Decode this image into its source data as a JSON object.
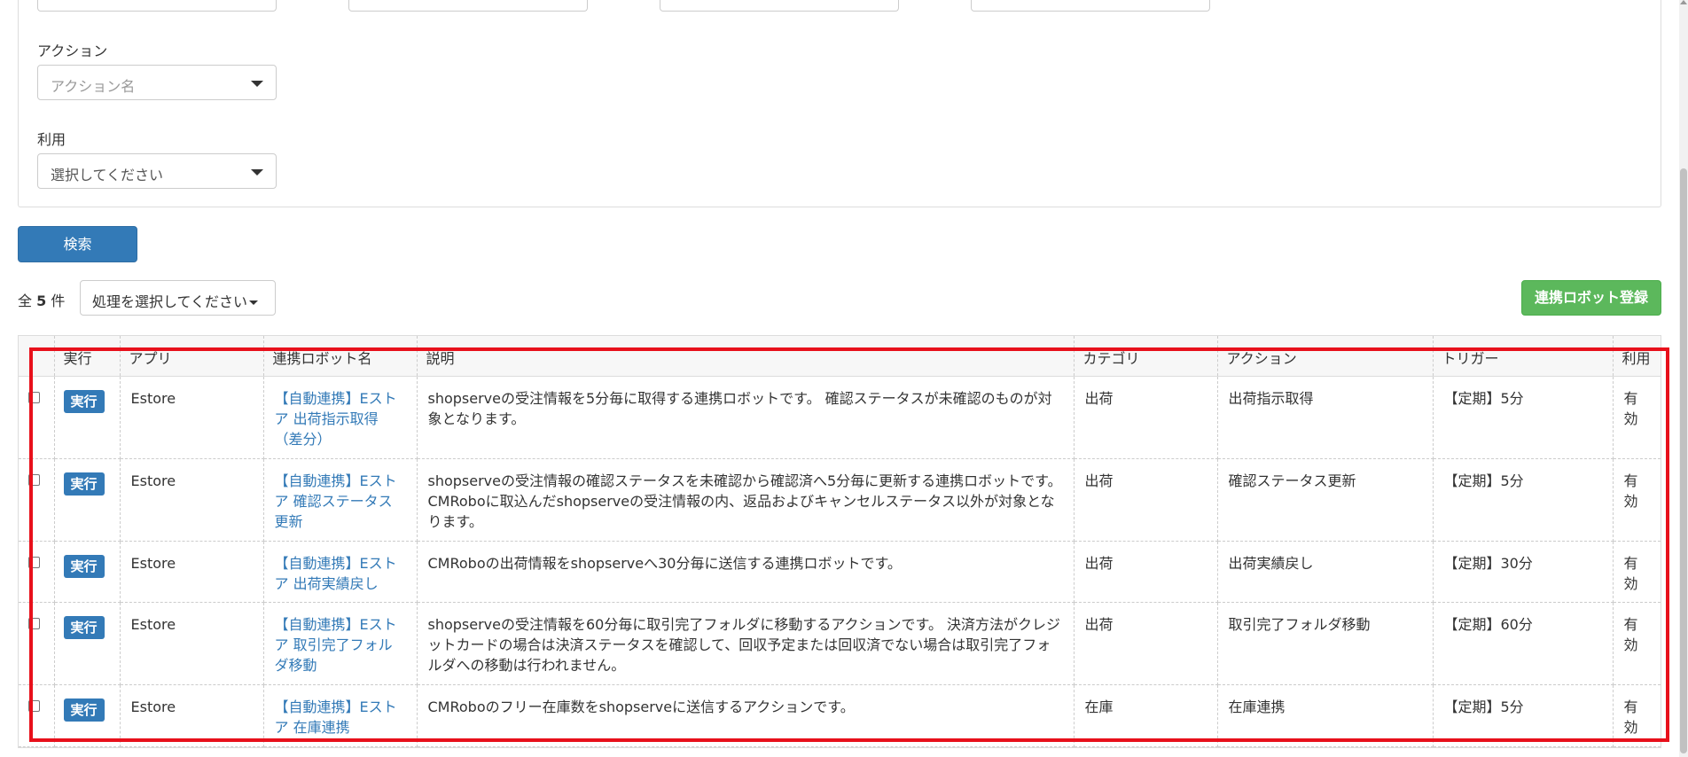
{
  "filters": {
    "action_label": "アクション",
    "action_placeholder": "アクション名",
    "use_label": "利用",
    "use_value": "選択してください"
  },
  "search_button": "検索",
  "list": {
    "count_prefix": "全",
    "count_value": "5",
    "count_suffix": "件",
    "bulk_action": "処理を選択してください",
    "register_button": "連携ロボット登録"
  },
  "table": {
    "headers": [
      "",
      "実行",
      "アプリ",
      "連携ロボット名",
      "説明",
      "カテゴリ",
      "アクション",
      "トリガー",
      "利用"
    ],
    "rows": [
      {
        "run": "実行",
        "app": "Estore",
        "name": "【自動連携】Eストア 出荷指示取得（差分）",
        "desc": "shopserveの受注情報を5分毎に取得する連携ロボットです。 確認ステータスが未確認のものが対象となります。",
        "category": "出荷",
        "action": "出荷指示取得",
        "trigger": "【定期】5分",
        "use": "有効"
      },
      {
        "run": "実行",
        "app": "Estore",
        "name": "【自動連携】Eストア 確認ステータス更新",
        "desc": "shopserveの受注情報の確認ステータスを未確認から確認済へ5分毎に更新する連携ロボットです。CMRoboに取込んだshopserveの受注情報の内、返品およびキャンセルステータス以外が対象となります。",
        "category": "出荷",
        "action": "確認ステータス更新",
        "trigger": "【定期】5分",
        "use": "有効"
      },
      {
        "run": "実行",
        "app": "Estore",
        "name": "【自動連携】Eストア 出荷実績戻し",
        "desc": "CMRoboの出荷情報をshopserveへ30分毎に送信する連携ロボットです。",
        "category": "出荷",
        "action": "出荷実績戻し",
        "trigger": "【定期】30分",
        "use": "有効"
      },
      {
        "run": "実行",
        "app": "Estore",
        "name": "【自動連携】Eストア 取引完了フォルダ移動",
        "desc": "shopserveの受注情報を60分毎に取引完了フォルダに移動するアクションです。 決済方法がクレジットカードの場合は決済ステータスを確認して、回収予定または回収済でない場合は取引完了フォルダへの移動は行われません。",
        "category": "出荷",
        "action": "取引完了フォルダ移動",
        "trigger": "【定期】60分",
        "use": "有効"
      },
      {
        "run": "実行",
        "app": "Estore",
        "name": "【自動連携】Eストア 在庫連携",
        "desc": "CMRoboのフリー在庫数をshopserveに送信するアクションです。",
        "category": "在庫",
        "action": "在庫連携",
        "trigger": "【定期】5分",
        "use": "有効"
      }
    ]
  },
  "colors": {
    "primary": "#337ab7",
    "success": "#5cb85c",
    "highlight": "#e8101b"
  }
}
